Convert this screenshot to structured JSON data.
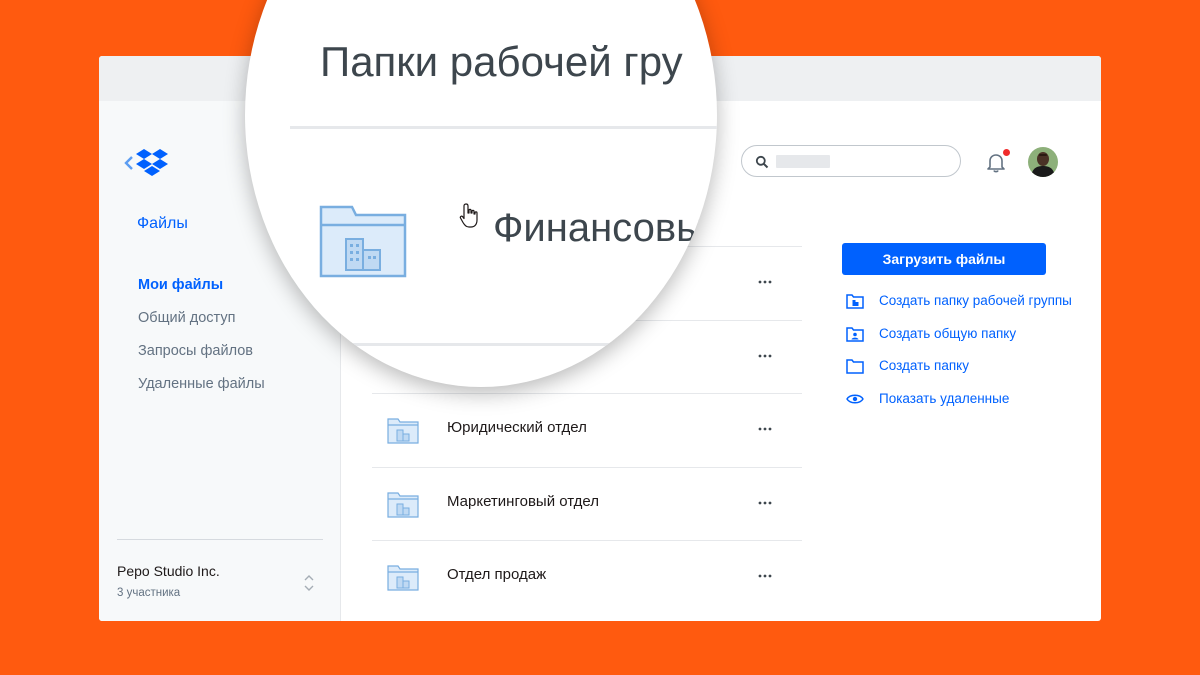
{
  "sidebar": {
    "title": "Файлы",
    "items": [
      {
        "label": "Мои файлы",
        "active": true
      },
      {
        "label": "Общий доступ",
        "active": false
      },
      {
        "label": "Запросы файлов",
        "active": false
      },
      {
        "label": "Удаленные файлы",
        "active": false
      }
    ],
    "team_name": "Pepo Studio Inc.",
    "team_members": "3 участника"
  },
  "files": [
    {
      "name": "Юридический отдел"
    },
    {
      "name": "Маркетинговый отдел"
    },
    {
      "name": "Отдел продаж"
    }
  ],
  "actions": {
    "upload_label": "Загрузить файлы",
    "items": [
      {
        "label": "Создать папку рабочей группы",
        "icon": "team-folder-icon"
      },
      {
        "label": "Создать общую папку",
        "icon": "shared-folder-icon"
      },
      {
        "label": "Создать папку",
        "icon": "folder-icon"
      },
      {
        "label": "Показать удаленные",
        "icon": "eye-icon"
      }
    ]
  },
  "magnifier": {
    "title": "Папки рабочей гру",
    "folder_name": "Финансовы"
  },
  "colors": {
    "background": "#FF5A0F",
    "accent": "#0061FE",
    "folder": "#79AEE0",
    "notification": "#F02B2B"
  }
}
